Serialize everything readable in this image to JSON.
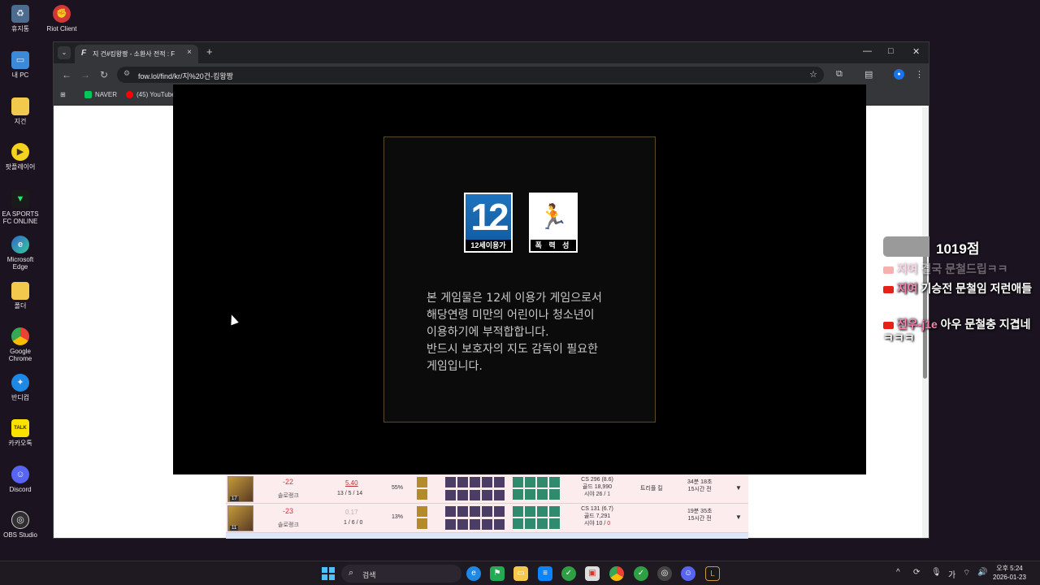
{
  "desktop": {
    "icons": [
      {
        "label": "휴지통",
        "icon": "recycle-bin-icon"
      },
      {
        "label": "내 PC",
        "icon": "monitor-icon"
      },
      {
        "label": "지건",
        "icon": "folder-icon"
      },
      {
        "label": "팟플레이어",
        "icon": "potplayer-icon"
      },
      {
        "label": "EA SPORTS FC ONLINE",
        "icon": "ea-fc-icon"
      },
      {
        "label": "Microsoft Edge",
        "icon": "edge-icon"
      },
      {
        "label": "폴더",
        "icon": "folder-icon"
      },
      {
        "label": "Google Chrome",
        "icon": "chrome-icon"
      },
      {
        "label": "반디컴",
        "icon": "bandicam-icon"
      },
      {
        "label": "카카오톡",
        "icon": "kakaotalk-icon"
      },
      {
        "label": "Discord",
        "icon": "discord-icon"
      },
      {
        "label": "OBS Studio",
        "icon": "obs-icon"
      }
    ],
    "riot_label": "Riot Client"
  },
  "browser": {
    "tab_title": "지 건#킹왕짱 - 소환사 전적 : F",
    "url": "fow.lol/find/kr/지%20건-킹왕짱",
    "bookmarks": [
      {
        "label": "NAVER",
        "color": "#03c75a"
      },
      {
        "label": "(45) YouTube",
        "color": "#ff0000"
      }
    ]
  },
  "game_rating": {
    "age_number": "12",
    "age_label": "12세이용가",
    "content_label": "폭 력 성",
    "notice_lines": [
      "본 게임물은 12세 이용가 게임으로서",
      "해당연령 미만의 어린이나 청소년이",
      "이용하기에 부적합합니다.",
      "반드시 보호자의 지도 감독이 필요한",
      "게임입니다."
    ]
  },
  "match_rows": [
    {
      "lp": "-22",
      "mode": "솔로랭크",
      "kda_ratio": "5.40",
      "kda": "13 / 5 / 14",
      "kp": "55%",
      "cs": "CS 296 (8.6)",
      "gold": "골드 18,990",
      "vision": "시야 26 / ",
      "ward": "1",
      "tag": "트리플 킬",
      "duration": "34분 18초",
      "ago": "15시간 전",
      "level": "17"
    },
    {
      "lp": "-23",
      "mode": "솔로랭크",
      "kda_ratio": "0.17",
      "kda": "1 / 6 / 0",
      "kp": "13%",
      "cs": "CS 131 (6.7)",
      "gold": "골드 7,291",
      "vision": "시야 10 / ",
      "ward": "0",
      "tag": "",
      "duration": "19분 35초",
      "ago": "15시간 전",
      "level": "11"
    }
  ],
  "chat": {
    "score": "1019점",
    "messages": [
      {
        "name": "지여",
        "text": "결국 문철드립ㅋㅋ"
      },
      {
        "name": "지여",
        "text": "기승전 문철임 저런애들"
      },
      {
        "name": "전우-j1e",
        "text": "아우 문철충 지겹네 ㅋㅋㅋ"
      }
    ]
  },
  "taskbar": {
    "search_placeholder": "검색",
    "ime": "가",
    "time": "오후 5:24",
    "date": "2026-01-23"
  }
}
